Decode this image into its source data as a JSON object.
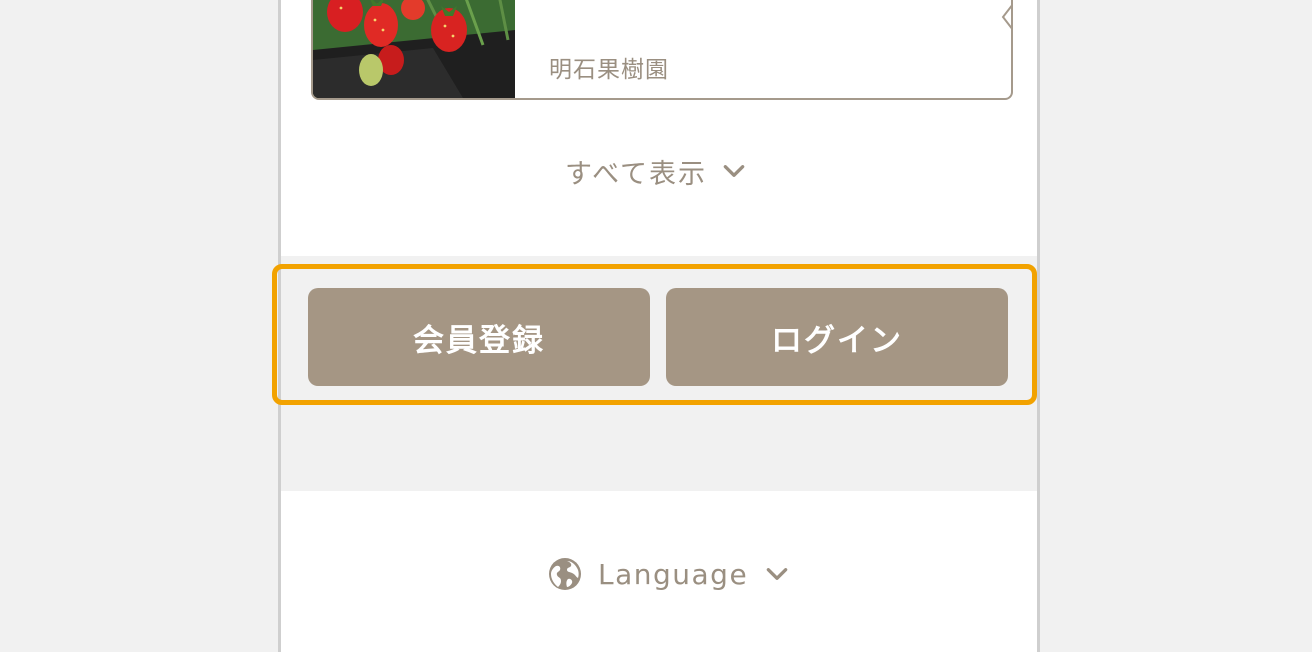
{
  "card": {
    "farm_name": "明石果樹園",
    "photo_icon": "strawberry-photo"
  },
  "show_all": {
    "label": "すべて表示",
    "icon": "chevron-down-icon"
  },
  "auth": {
    "register_label": "会員登録",
    "login_label": "ログイン"
  },
  "language": {
    "label": "Language",
    "icon": "globe-icon",
    "chevron": "chevron-down-icon"
  },
  "colors": {
    "button_bg": "#a59684",
    "text_muted": "#9a8f81",
    "highlight": "#f2a200",
    "band_bg": "#f1f1f1"
  }
}
